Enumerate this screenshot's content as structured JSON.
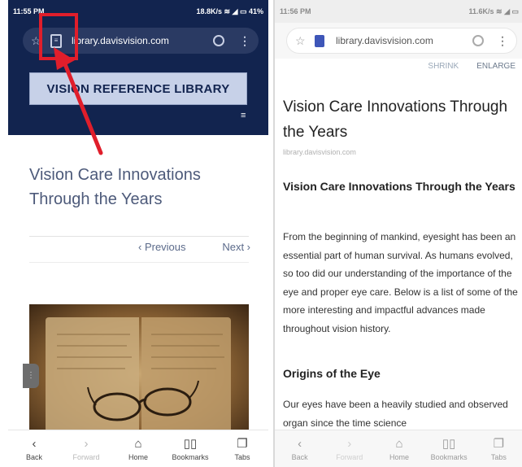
{
  "left": {
    "status": {
      "time": "11:55 PM",
      "right": "18.8K/s ≋ ◢ ▭ 41%"
    },
    "url": "library.davisvision.com",
    "logo_text": "VISION REFERENCE LIBRARY",
    "hamburger": "≡",
    "title": "Vision Care Innovations Through the Years",
    "pager": {
      "previous": "‹ Previous",
      "next": "Next ›"
    },
    "nav": [
      {
        "label": "Back",
        "glyph": "‹"
      },
      {
        "label": "Forward",
        "glyph": "›"
      },
      {
        "label": "Home",
        "glyph": "⌂"
      },
      {
        "label": "Bookmarks",
        "glyph": "▯▯"
      },
      {
        "label": "Tabs",
        "glyph": "❐"
      }
    ]
  },
  "right": {
    "status": {
      "time": "11:56 PM",
      "right": "11.6K/s ≋ ◢ ▭"
    },
    "url": "library.davisvision.com",
    "reader": {
      "shrink": "SHRINK",
      "enlarge": "ENLARGE"
    },
    "title": "Vision Care Innovations Through the Years",
    "domain": "library.davisvision.com",
    "heading": "Vision Care Innovations Through the Years",
    "paragraph": "From the beginning of mankind, eyesight has been an essential part of human survival. As humans evolved, so too did our understanding of the importance of the eye and proper eye care. Below is a list of some of the more interesting and impactful advances made throughout vision history.",
    "subheading": "Origins of the Eye",
    "paragraph2": "Our eyes have been a heavily studied and observed organ since the time science",
    "nav": [
      {
        "label": "Back",
        "glyph": "‹"
      },
      {
        "label": "Forward",
        "glyph": "›"
      },
      {
        "label": "Home",
        "glyph": "⌂"
      },
      {
        "label": "Bookmarks",
        "glyph": "▯▯"
      },
      {
        "label": "Tabs",
        "glyph": "❐"
      }
    ]
  },
  "colors": {
    "header_navy": "#12244f",
    "annotation_red": "#e01e2b",
    "title_slate": "#4d5a7a"
  }
}
